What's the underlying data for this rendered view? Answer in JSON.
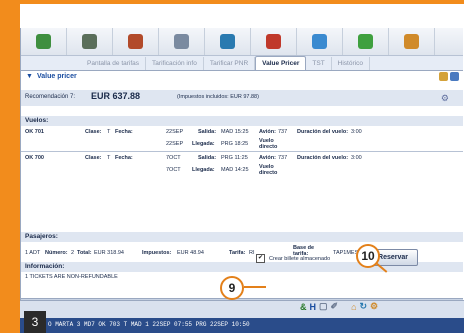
{
  "tool_icons": [
    {
      "name": "passenger-icon",
      "color": "#3f8f3f"
    },
    {
      "name": "pnr-icon",
      "color": "#5a6e5a"
    },
    {
      "name": "fare-icon",
      "color": "#b24a2a"
    },
    {
      "name": "airline-icon",
      "color": "#7a8aa0"
    },
    {
      "name": "car-icon",
      "color": "#2a7ab0"
    },
    {
      "name": "traveler-icon",
      "color": "#c0392b"
    },
    {
      "name": "map-icon",
      "color": "#3a8ad0"
    },
    {
      "name": "hotel-icon",
      "color": "#3fa03f"
    },
    {
      "name": "misc-icon",
      "color": "#d08a2a"
    }
  ],
  "tabs": [
    {
      "label": "Pantalla de tarifas",
      "active": false
    },
    {
      "label": "Tarificación info",
      "active": false
    },
    {
      "label": "Tarificar PNR",
      "active": false
    },
    {
      "label": "Value Pricer",
      "active": true
    },
    {
      "label": "TST",
      "active": false
    },
    {
      "label": "Histórico",
      "active": false
    }
  ],
  "page_title": "Value pricer",
  "recommendation": {
    "label": "Recomendación 7:",
    "amount": "EUR 637.88",
    "taxes": "(Impuestos incluidos: EUR 97.88)"
  },
  "flights": {
    "heading": "Vuelos:",
    "rows": [
      {
        "seg": "OK 701",
        "clase_label": "Clase:",
        "clase": "T",
        "fecha_label": "Fecha:",
        "fecha1": "22SEP",
        "fecha2": "22SEP",
        "salida_label": "Salida:",
        "salida": "MAD 15:25",
        "llegada_label": "Llegada:",
        "llegada": "PRG 18:25",
        "avion_label": "Avión:",
        "avion": "737",
        "duracion_label": "Duración del vuelo:",
        "duracion": "3:00",
        "tipo": "Vuelo directo"
      },
      {
        "seg": "OK 700",
        "clase_label": "Clase:",
        "clase": "T",
        "fecha_label": "Fecha:",
        "fecha1": "7OCT",
        "fecha2": "7OCT",
        "salida_label": "Salida:",
        "salida": "PRG 11:25",
        "llegada_label": "Llegada:",
        "llegada": "MAD 14:25",
        "avion_label": "Avión:",
        "avion": "737",
        "duracion_label": "Duración del vuelo:",
        "duracion": "3:00",
        "tipo": "Vuelo directo"
      }
    ]
  },
  "passengers": {
    "heading": "Pasajeros:",
    "row": {
      "type": "1 ADT",
      "numero_label": "Número:",
      "numero": "2",
      "total_label": "Total:",
      "total": "EUR 318.94",
      "impuestos_label": "Impuestos:",
      "impuestos": "EUR 48.94",
      "tarifa_label": "Tarifa:",
      "tarifa": "RI",
      "base_label": "Base de tarifa:",
      "base": "TAP1MES, TAP1MES"
    }
  },
  "information": {
    "heading": "Información:",
    "row": "1   TICKETS ARE NON-REFUNDABLE"
  },
  "save_checkbox": {
    "label": "Crear billete almacenado",
    "checked": "✔"
  },
  "reserve_button": "Reservar",
  "callouts": {
    "checkbox": "9",
    "button": "10"
  },
  "step_badge": "3",
  "status_line": "O MARTA        3 MD7  OK   703  T    MAD  1 22SEP  07:55  PRG 22SEP  10:50",
  "colors": {
    "accent": "#f28c1c",
    "link": "#1a4da0",
    "band": "#dfe6f1"
  }
}
